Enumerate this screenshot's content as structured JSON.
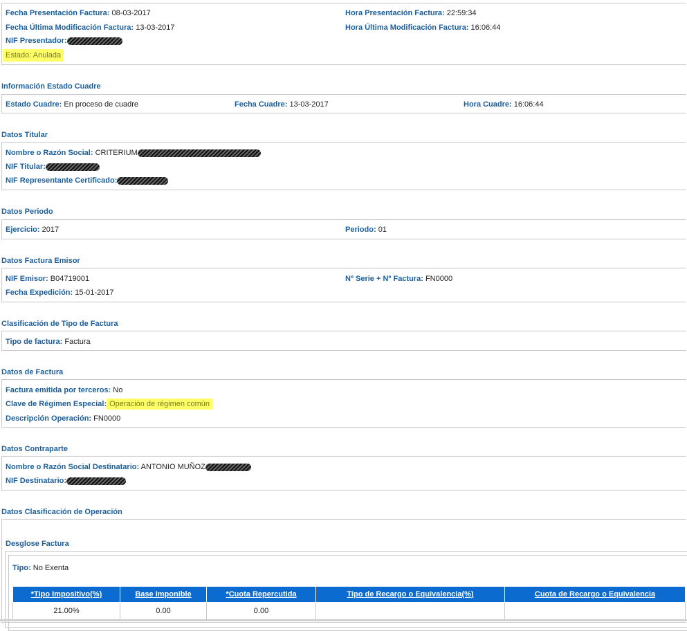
{
  "invoice": {
    "fecha_presentacion_label": "Fecha Presentación Factura:",
    "fecha_presentacion": "08-03-2017",
    "hora_presentacion_label": "Hora Presentación Factura:",
    "hora_presentacion": "22:59:34",
    "fecha_mod_label": "Fecha Última Modificación Factura:",
    "fecha_mod": "13-03-2017",
    "hora_mod_label": "Hora Última Modificación Factura:",
    "hora_mod": "16:06:44",
    "nif_presentador_label": "NIF Presentador:",
    "estado_label": "Estado:",
    "estado": "Anulada"
  },
  "cuadre": {
    "title": "Información Estado Cuadre",
    "estado_label": "Estado Cuadre:",
    "estado": "En proceso de cuadre",
    "fecha_label": "Fecha Cuadre:",
    "fecha": "13-03-2017",
    "hora_label": "Hora Cuadre:",
    "hora": "16:06:44"
  },
  "titular": {
    "title": "Datos Titular",
    "nombre_label": "Nombre o Razón Social:",
    "nombre": "CRITERIUM",
    "nif_label": "NIF Titular:",
    "nif_rep_label": "NIF Representante Certificado:"
  },
  "periodo": {
    "title": "Datos Periodo",
    "ejercicio_label": "Ejercicio:",
    "ejercicio": "2017",
    "periodo_label": "Periodo:",
    "periodo": "01"
  },
  "emisor": {
    "title": "Datos Factura Emisor",
    "nif_label": "NIF Emisor:",
    "nif": "B04719001",
    "serie_label": "Nº Serie + Nº Factura:",
    "serie": "FN0000",
    "fecha_label": "Fecha Expedición:",
    "fecha": "15-01-2017"
  },
  "clasificacion": {
    "title": "Clasificación de Tipo de Factura",
    "tipo_label": "Tipo de factura:",
    "tipo": "Factura"
  },
  "factura": {
    "title": "Datos de Factura",
    "terceros_label": "Factura emitida por terceros:",
    "terceros": "No",
    "clave_label": "Clave de Régimen Especial:",
    "clave": "Operación de régimen común",
    "descripcion_label": "Descripción Operación:",
    "descripcion": "FN0000"
  },
  "contraparte": {
    "title": "Datos Contraparte",
    "nombre_label": "Nombre o Razón Social Destinatario:",
    "nombre": "ANTONIO MUÑOZ",
    "nif_label": "NIF Destinatario:"
  },
  "operacion": {
    "title": "Datos Clasificación de Operación",
    "desglose_title": "Desglose Factura",
    "tipo_label": "Tipo:",
    "tipo": "No Exenta",
    "table": {
      "headers": [
        "*Tipo Impositivo(%)",
        "Base Imponible",
        "*Cuota Repercutida",
        "Tipo de Recargo o Equivalencia(%)",
        "Cuota de Recargo o Equivalencia"
      ],
      "rows": [
        [
          "21.00%",
          "0.00",
          "0.00",
          "",
          ""
        ]
      ]
    }
  },
  "colors": {
    "label": "#1a5e9e",
    "header_bg": "#0c6bd0",
    "highlight": "#ffff66"
  }
}
